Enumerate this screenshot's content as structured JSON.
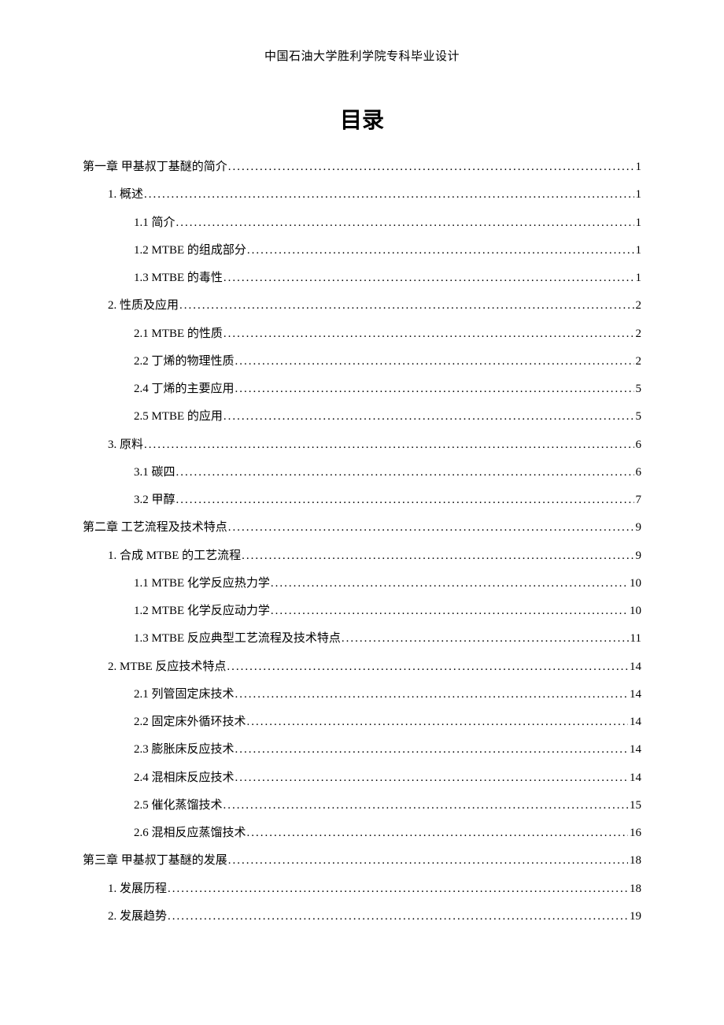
{
  "header": "中国石油大学胜利学院专科毕业设计",
  "title": "目录",
  "toc": [
    {
      "indent": 0,
      "label": "第一章   甲基叔丁基醚的简介 ",
      "page": "1"
    },
    {
      "indent": 1,
      "label": "1.  概述",
      "page": "1"
    },
    {
      "indent": 2,
      "label": "1.1 简介 ",
      "page": "1"
    },
    {
      "indent": 2,
      "label": "1.2 MTBE 的组成部分",
      "page": "1"
    },
    {
      "indent": 2,
      "label": "1.3 MTBE 的毒性",
      "page": "1"
    },
    {
      "indent": 1,
      "label": "2.  性质及应用",
      "page": "2"
    },
    {
      "indent": 2,
      "label": "2.1 MTBE 的性质 ",
      "page": "2"
    },
    {
      "indent": 2,
      "label": "2.2 丁烯的物理性质 ",
      "page": "2"
    },
    {
      "indent": 2,
      "label": "2.4 丁烯的主要应用 ",
      "page": "5"
    },
    {
      "indent": 2,
      "label": "2.5 MTBE 的应用",
      "page": "5"
    },
    {
      "indent": 1,
      "label": "3.  原料",
      "page": "6"
    },
    {
      "indent": 2,
      "label": "3.1 碳四 ",
      "page": "6"
    },
    {
      "indent": 2,
      "label": "3.2 甲醇 ",
      "page": "7"
    },
    {
      "indent": 0,
      "label": "第二章   工艺流程及技术特点 ",
      "page": "9"
    },
    {
      "indent": 1,
      "label": "1.  合成 MTBE 的工艺流程",
      "page": "9"
    },
    {
      "indent": 2,
      "label": "1.1 MTBE 化学反应热力学",
      "page": "10"
    },
    {
      "indent": 2,
      "label": "1.2 MTBE 化学反应动力学",
      "page": "10"
    },
    {
      "indent": 2,
      "label": "1.3 MTBE 反应典型工艺流程及技术特点",
      "page": "11"
    },
    {
      "indent": 1,
      "label": "2.  MTBE 反应技术特点 ",
      "page": "14"
    },
    {
      "indent": 2,
      "label": "2.1 列管固定床技术 ",
      "page": "14"
    },
    {
      "indent": 2,
      "label": "2.2 固定床外循环技术 ",
      "page": "14"
    },
    {
      "indent": 2,
      "label": "2.3 膨胀床反应技术 ",
      "page": "14"
    },
    {
      "indent": 2,
      "label": "2.4 混相床反应技术 ",
      "page": "14"
    },
    {
      "indent": 2,
      "label": "2.5 催化蒸馏技术 ",
      "page": "15"
    },
    {
      "indent": 2,
      "label": "2.6 混相反应蒸馏技术 ",
      "page": "16"
    },
    {
      "indent": 0,
      "label": "第三章   甲基叔丁基醚的发展 ",
      "page": "18"
    },
    {
      "indent": 1,
      "label": "1.  发展历程",
      "page": "18"
    },
    {
      "indent": 1,
      "label": "2.  发展趋势",
      "page": "19"
    }
  ]
}
